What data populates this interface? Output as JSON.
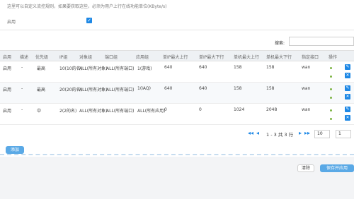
{
  "tip": "这里可以自定义流控规则，如果要获取这些，必须为用户上行在线功能单位(KByte/s)",
  "enable": {
    "label": "启用",
    "checked": true,
    "check_glyph": "✓"
  },
  "search": {
    "label": "搜索:",
    "placeholder": ""
  },
  "table": {
    "headers": [
      "启用",
      "描述",
      "优先级",
      "IP组",
      "对象组",
      "端口组",
      "应用组",
      "单IP最大上行",
      "单IP最大下行",
      "单机最大上行",
      "单机最大下行",
      "指定接口",
      "操作"
    ],
    "rows": [
      {
        "cells": [
          "启用",
          "-",
          "最高",
          "10(10的名)",
          "ALL(所有对象)",
          "ALL(所有端口)",
          "1(游戏)",
          "640",
          "640",
          "158",
          "158",
          "wan"
        ]
      },
      {
        "cells": [
          "启用",
          "-",
          "最高",
          "20(20的名)",
          "ALL(所有对象)",
          "ALL(所有端口)",
          "1(IAQ)",
          "640",
          "640",
          "158",
          "158",
          "wan"
        ]
      },
      {
        "cells": [
          "启用",
          "-",
          "中",
          "2(2的名)",
          "ALL(所有对象)",
          "ALL(所有端口)",
          "ALL(所有应用)",
          "0",
          "0",
          "1024",
          "2048",
          "wan"
        ]
      }
    ]
  },
  "pager": {
    "first": "◂◂",
    "prev": "◂",
    "text": "1 - 3 共 3 行",
    "next": "▸",
    "last": "▸▸",
    "page_size": "10",
    "page_num": "1"
  },
  "buttons": {
    "add": "添加",
    "clear": "清除",
    "save": "保存并应用"
  },
  "colors": {
    "accent": "#1e88e5",
    "button_blue": "#5aa9e6",
    "status_green": "#7cb342"
  }
}
